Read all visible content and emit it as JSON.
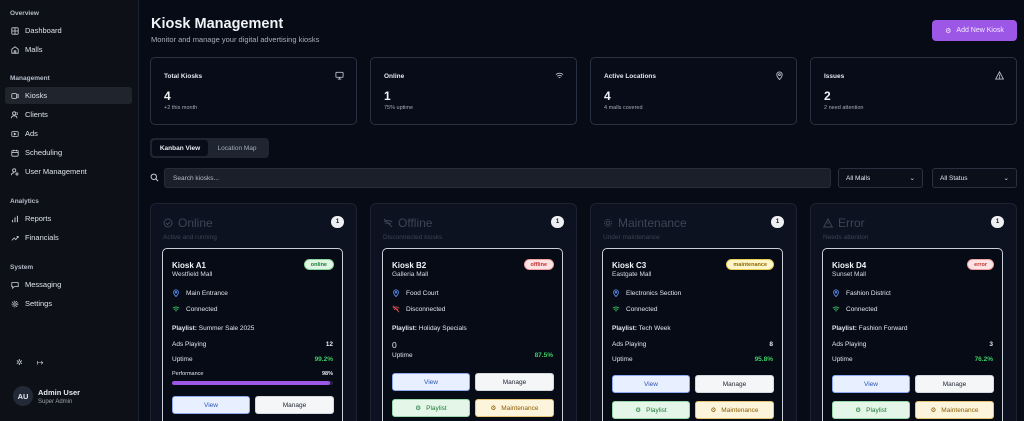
{
  "sidebar": {
    "sections": [
      {
        "label": "Overview",
        "items": [
          {
            "label": "Dashboard",
            "icon": "dashboard-icon"
          },
          {
            "label": "Malls",
            "icon": "building-icon"
          }
        ]
      },
      {
        "label": "Management",
        "items": [
          {
            "label": "Kiosks",
            "icon": "monitor-icon",
            "active": true
          },
          {
            "label": "Clients",
            "icon": "users-icon"
          },
          {
            "label": "Ads",
            "icon": "megaphone-icon"
          },
          {
            "label": "Scheduling",
            "icon": "calendar-icon"
          },
          {
            "label": "User Management",
            "icon": "user-cog-icon"
          }
        ]
      },
      {
        "label": "Analytics",
        "items": [
          {
            "label": "Reports",
            "icon": "bar-chart-icon"
          },
          {
            "label": "Financials",
            "icon": "trending-up-icon"
          }
        ]
      },
      {
        "label": "System",
        "items": [
          {
            "label": "Messaging",
            "icon": "message-icon"
          },
          {
            "label": "Settings",
            "icon": "gear-icon"
          }
        ]
      }
    ],
    "user": {
      "initials": "AU",
      "name": "Admin User",
      "role": "Super Admin"
    }
  },
  "header": {
    "title": "Kiosk Management",
    "subtitle": "Monitor and manage your digital advertising kiosks",
    "add_label": "Add New Kiosk"
  },
  "stats": [
    {
      "label": "Total Kiosks",
      "value": "4",
      "sub": "+2 this month",
      "icon": "monitor-icon"
    },
    {
      "label": "Online",
      "value": "1",
      "sub": "75% uptime",
      "icon": "wifi-icon"
    },
    {
      "label": "Active Locations",
      "value": "4",
      "sub": "4 malls covered",
      "icon": "map-pin-icon"
    },
    {
      "label": "Issues",
      "value": "2",
      "sub": "2 need attention",
      "icon": "warning-icon"
    }
  ],
  "tabs": {
    "kanban": "Kanban View",
    "map": "Location Map"
  },
  "search": {
    "placeholder": "Search kiosks..."
  },
  "filters": {
    "malls": "All Malls",
    "status": "All Status"
  },
  "columns": [
    {
      "title": "Online",
      "desc": "Active and running",
      "count": "1",
      "card": {
        "name": "Kiosk A1",
        "mall": "Westfield Mall",
        "badge": "online",
        "location": "Main Entrance",
        "conn": "Connected",
        "playlist_label": "Playlist:",
        "playlist": "Summer Sale 2025",
        "ads_label": "Ads Playing",
        "ads": "12",
        "uptime_label": "Uptime",
        "uptime": "99.2%",
        "perf_label": "Performance",
        "perf": "98%",
        "perf_value": 98,
        "view": "View",
        "manage": "Manage"
      }
    },
    {
      "title": "Offline",
      "desc": "Disconnected kiosks",
      "count": "1",
      "card": {
        "name": "Kiosk B2",
        "mall": "Galleria Mall",
        "badge": "offline",
        "location": "Food Court",
        "conn": "Disconnected",
        "playlist_label": "Playlist:",
        "playlist": "Holiday Specials",
        "ads": "0",
        "uptime_label": "Uptime",
        "uptime": "87.5%",
        "view": "View",
        "manage": "Manage",
        "playlist_btn": "Playlist",
        "maint_btn": "Maintenance"
      }
    },
    {
      "title": "Maintenance",
      "desc": "Under maintenance",
      "count": "1",
      "card": {
        "name": "Kiosk C3",
        "mall": "Eastgate Mall",
        "badge": "maintenance",
        "location": "Electronics Section",
        "conn": "Connected",
        "playlist_label": "Playlist:",
        "playlist": "Tech Week",
        "ads_label": "Ads Playing",
        "ads": "8",
        "uptime_label": "Uptime",
        "uptime": "95.8%",
        "view": "View",
        "manage": "Manage",
        "playlist_btn": "Playlist",
        "maint_btn": "Maintenance"
      }
    },
    {
      "title": "Error",
      "desc": "Needs attention",
      "count": "1",
      "card": {
        "name": "Kiosk D4",
        "mall": "Sunset Mall",
        "badge": "error",
        "location": "Fashion District",
        "conn": "Connected",
        "playlist_label": "Playlist:",
        "playlist": "Fashion Forward",
        "ads_label": "Ads Playing",
        "ads": "3",
        "uptime_label": "Uptime",
        "uptime": "76.2%",
        "view": "View",
        "manage": "Manage",
        "playlist_btn": "Playlist",
        "maint_btn": "Maintenance"
      }
    }
  ],
  "colors": {
    "accent": "#9c57e6",
    "success": "#3ecf65",
    "background": "#060b16"
  }
}
